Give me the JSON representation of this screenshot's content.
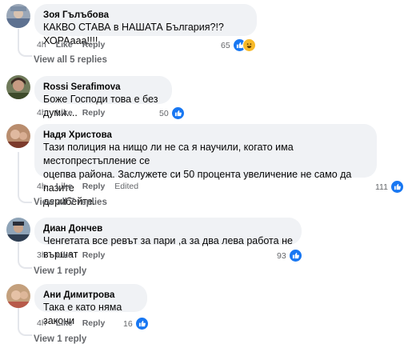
{
  "comments": [
    {
      "author": "Зоя Гълъбова",
      "text": "КАКВО СТАВА в НАШАТА България?!? ХОРАааа!!!!",
      "time": "4h",
      "like": "Like",
      "reply": "Reply",
      "reaction_count": "65",
      "view_replies": "View all 5 replies"
    },
    {
      "author": "Rossi Serafimova",
      "text": "Боже Господи това е без думи....",
      "time": "4h",
      "like": "Like",
      "reply": "Reply",
      "reaction_count": "50"
    },
    {
      "author": "Надя Христова",
      "text_lines": [
        "Тази полиция на нищо ли не са я научили, когато има местопрестъпление се",
        "оцепва района. Заслужете си 50 процента увеличение не само да пазите",
        "дерибейте."
      ],
      "time": "4h",
      "like": "Like",
      "reply": "Reply",
      "edited": "Edited",
      "reaction_count": "111",
      "view_replies": "View all 7 replies"
    },
    {
      "author": "Диан Дончев",
      "text": "Ченгетата все ревът за пари ,а за два лева работа не вършат",
      "time": "3h",
      "like": "Like",
      "reply": "Reply",
      "reaction_count": "93",
      "view_replies": "View 1 reply"
    },
    {
      "author": "Ани Димитрова",
      "text": "Така е като няма закони",
      "time": "4h",
      "like": "Like",
      "reply": "Reply",
      "reaction_count": "16",
      "view_replies": "View 1 reply"
    }
  ],
  "colors": {
    "like_blue": "#1877f2",
    "haha_yellow": "#f7b928",
    "bubble": "#f0f2f5",
    "meta": "#65676b"
  }
}
